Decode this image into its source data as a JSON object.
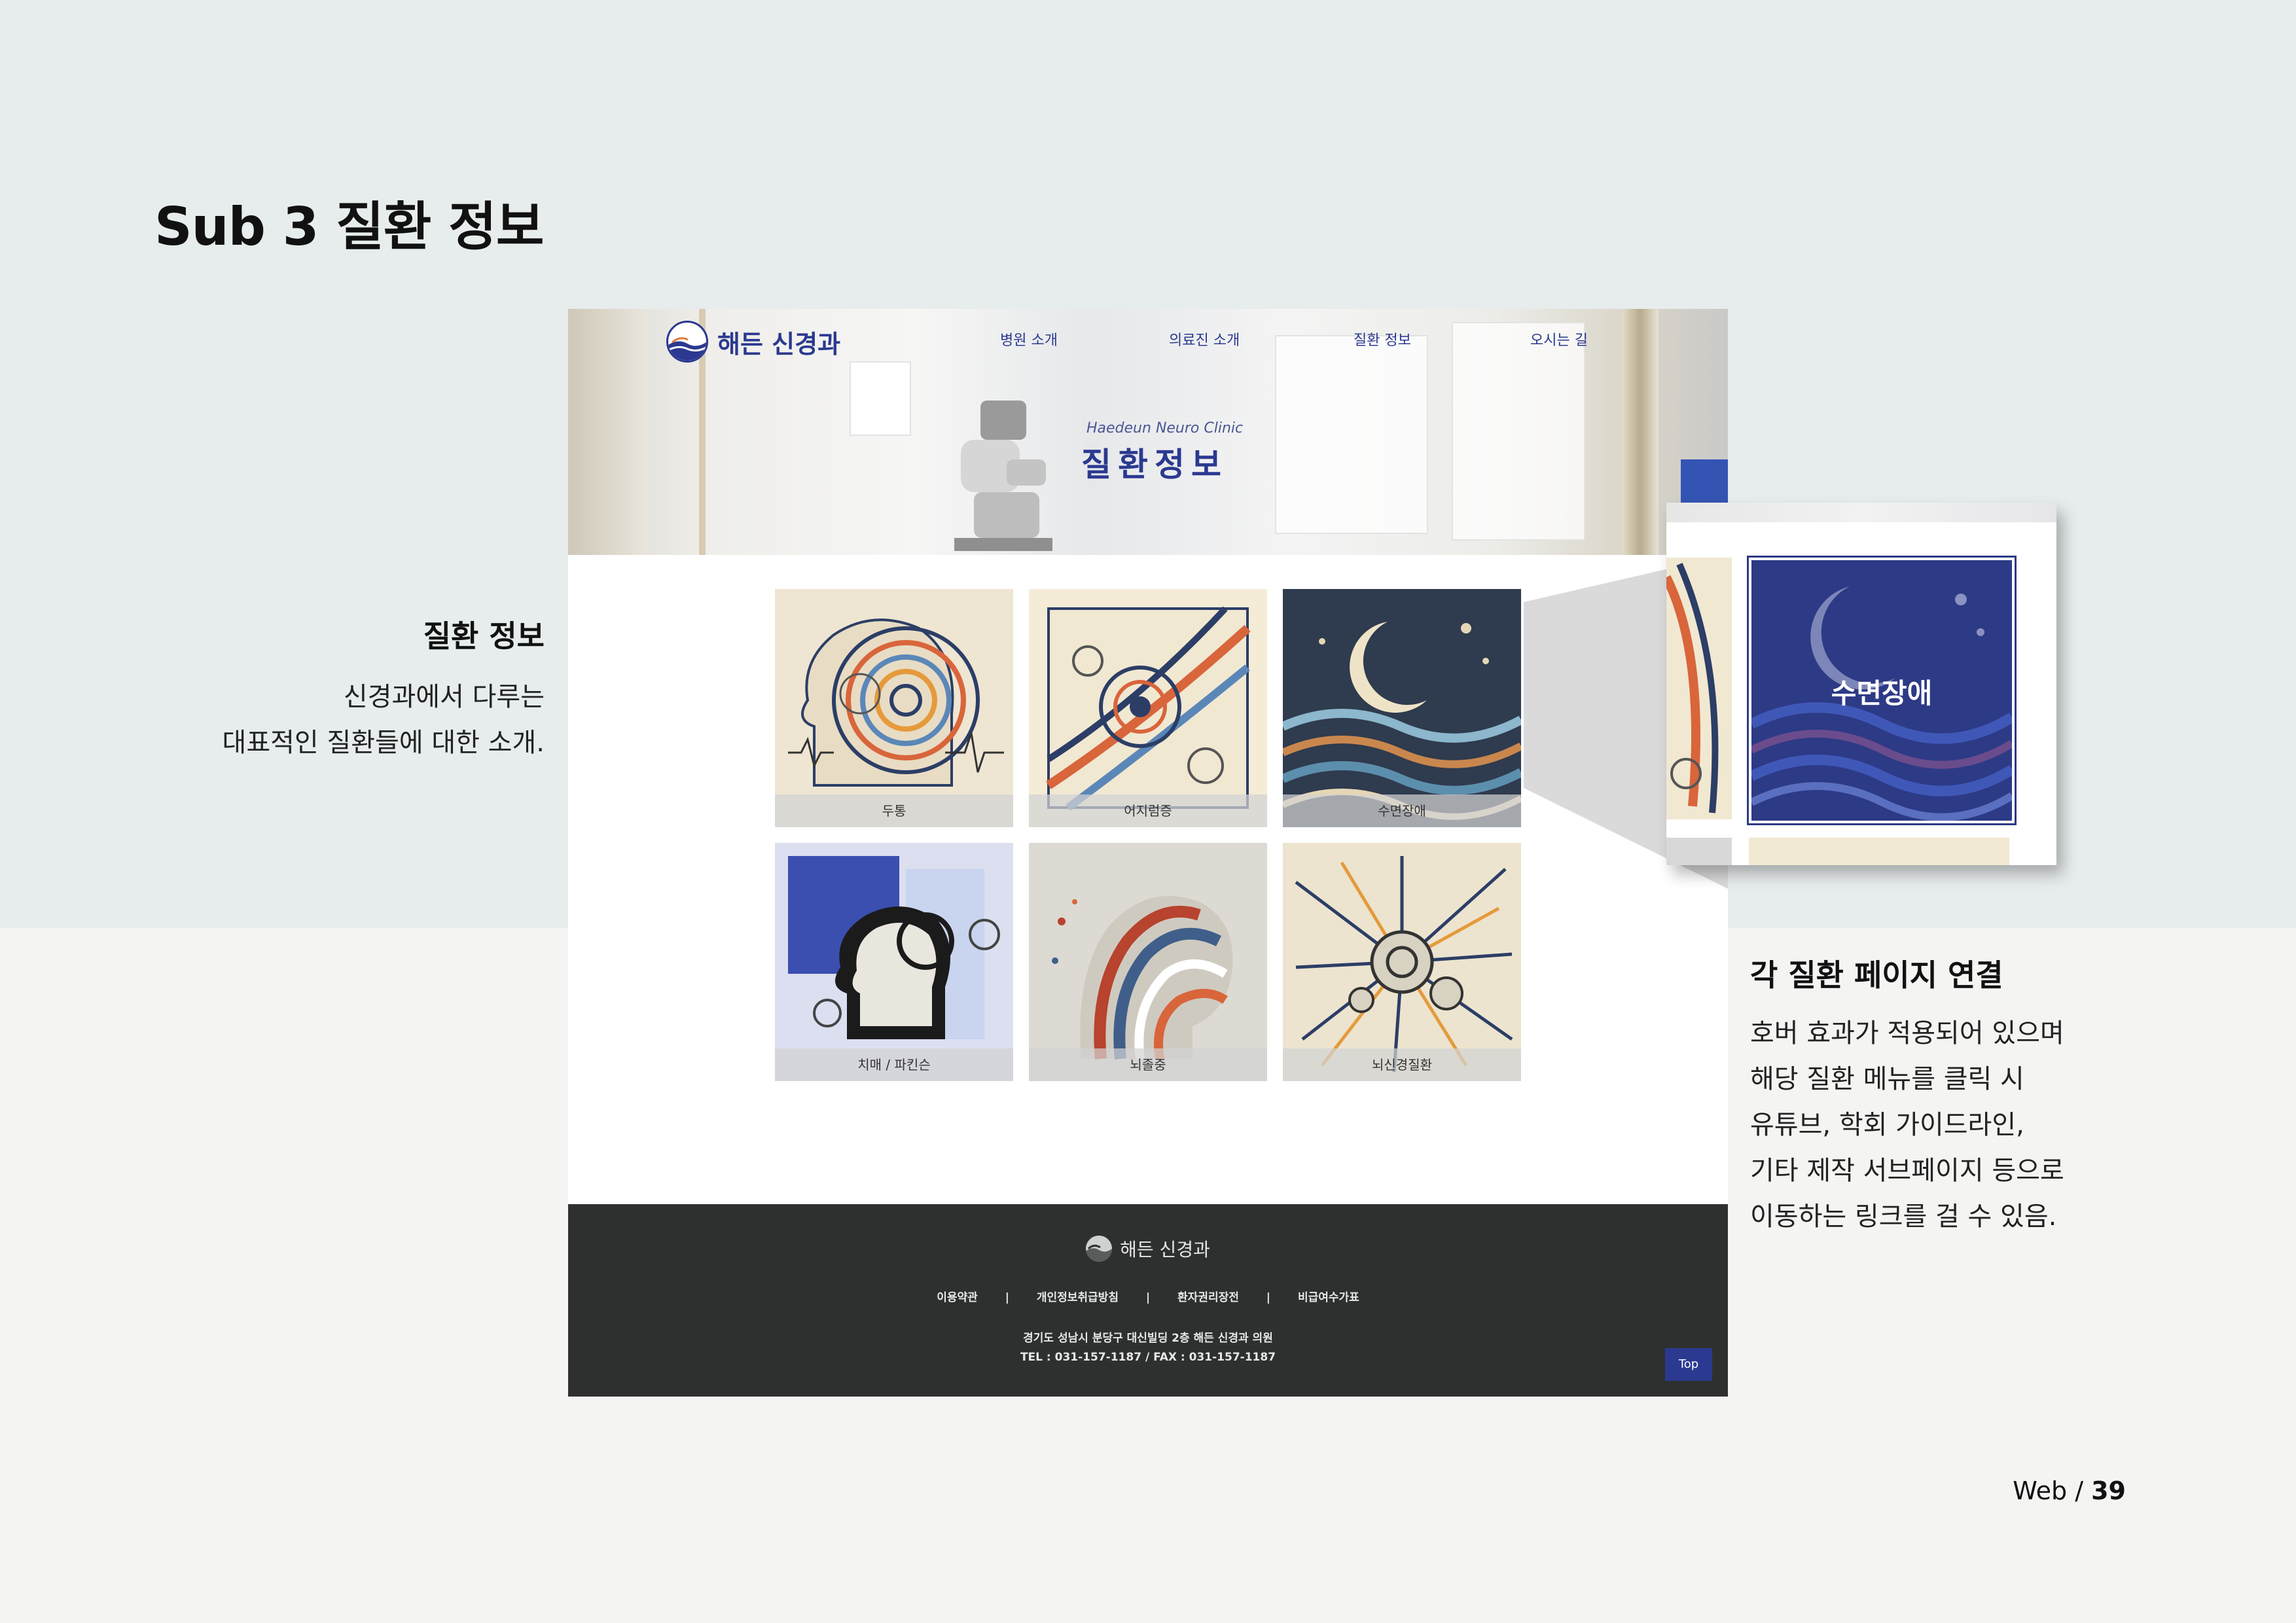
{
  "slide": {
    "heading": "Sub 3 질환 정보",
    "left_note": {
      "title": "질환 정보",
      "line1": "신경과에서 다루는",
      "line2": "대표적인 질환들에 대한 소개."
    },
    "right_note": {
      "title": "각 질환 페이지 연결",
      "line1": "호버 효과가 적용되어 있으며",
      "line2": "해당 질환 메뉴를 클릭 시",
      "line3": "유튜브, 학회 가이드라인,",
      "line4": "기타 제작 서브페이지 등으로",
      "line5": "이동하는 링크를 걸 수 있음."
    },
    "page_label": "Web /",
    "page_number": "39"
  },
  "site": {
    "logo_text": "해든 신경과",
    "nav": [
      "병원 소개",
      "의료진 소개",
      "질환 정보",
      "오시는 길"
    ],
    "hero_subtitle": "Haedeun Neuro Clinic",
    "hero_title": "질환정보",
    "cards": [
      {
        "label": "두통"
      },
      {
        "label": "어지럼증"
      },
      {
        "label": "수면장애"
      },
      {
        "label": "치매 / 파킨슨"
      },
      {
        "label": "뇌졸중"
      },
      {
        "label": "뇌신경질환"
      }
    ],
    "footer": {
      "logo_text": "해든 신경과",
      "links": [
        "이용약관",
        "개인정보취급방침",
        "환자권리장전",
        "비급여수가표"
      ],
      "separator": "|",
      "address": "경기도 성남시 분당구 대신빌딩 2층 해든 신경과 의원",
      "tel": "TEL : 031-157-1187 / FAX : 031-157-1187",
      "top_button": "Top"
    }
  },
  "callout": {
    "label": "수면장애"
  },
  "colors": {
    "brand": "#2b3990",
    "footer_bg": "#2e3030",
    "slide_top_bg": "#e7eced",
    "slide_bottom_bg": "#f4f4f2"
  }
}
